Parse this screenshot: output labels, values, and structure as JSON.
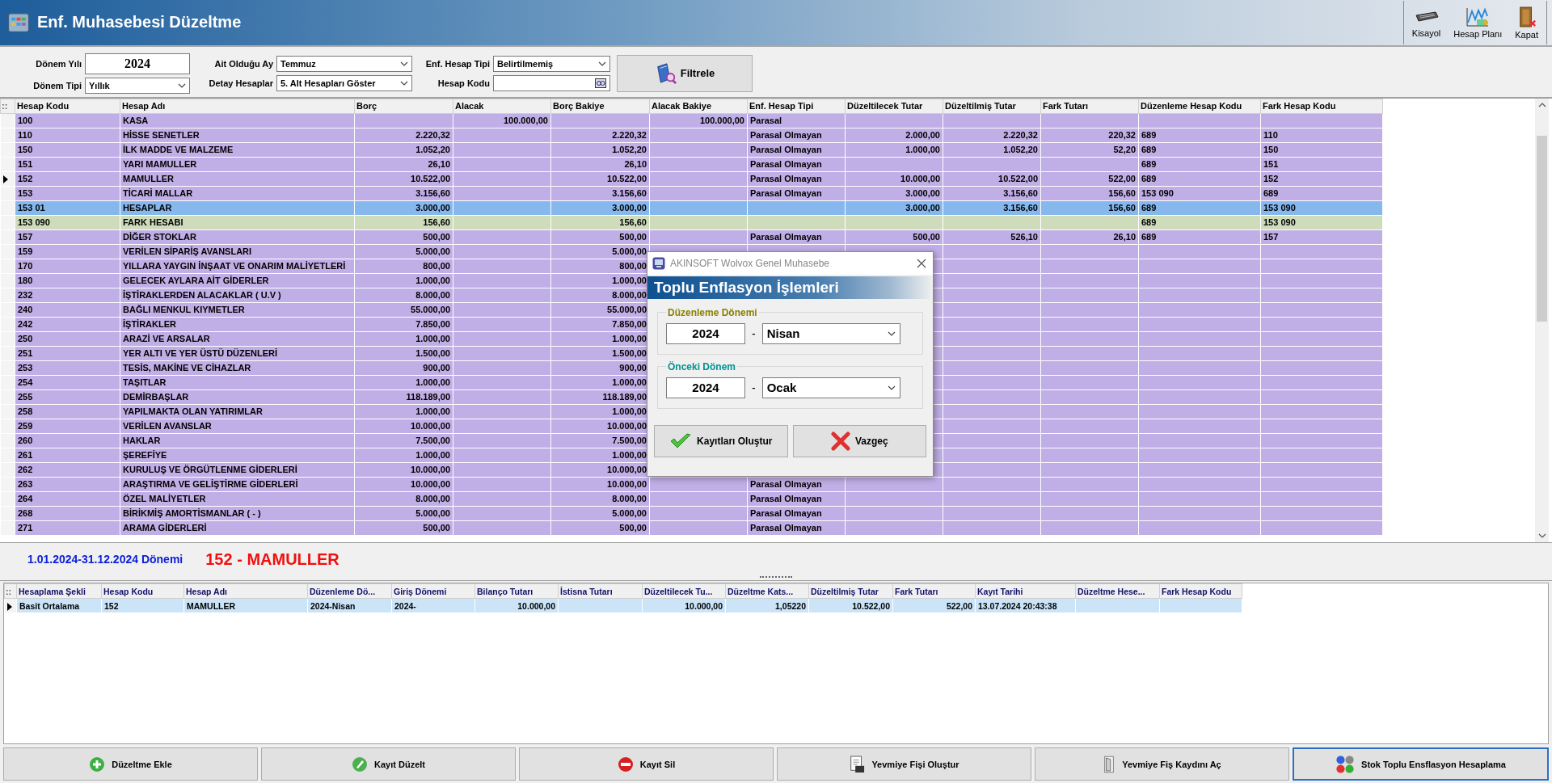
{
  "window": {
    "title": "Enf. Muhasebesi Düzeltme"
  },
  "toolbar": [
    {
      "label": "Kisayol",
      "kind": "keyboard"
    },
    {
      "label": "Hesap Planı",
      "kind": "chart"
    },
    {
      "label": "Kapat",
      "kind": "exit"
    }
  ],
  "filters": {
    "donem_yili": {
      "label": "Dönem Yılı",
      "value": "2024"
    },
    "donem_tipi": {
      "label": "Dönem Tipi",
      "value": "Yıllık"
    },
    "ait_oldugu_ay": {
      "label": "Ait Olduğu Ay",
      "value": "Temmuz"
    },
    "detay_hesaplar": {
      "label": "Detay Hesaplar",
      "value": "5. Alt Hesapları Göster"
    },
    "enf_hesap_tipi": {
      "label": "Enf. Hesap Tipi",
      "value": "Belirtilmemiş"
    },
    "hesap_kodu": {
      "label": "Hesap Kodu"
    },
    "filter_button": "Filtrele"
  },
  "main_grid": {
    "corner": "::",
    "columns": [
      "Hesap Kodu",
      "Hesap Adı",
      "Borç",
      "Alacak",
      "Borç Bakiye",
      "Alacak Bakiye",
      "Enf. Hesap Tipi",
      "Düzeltilecek Tutar",
      "Düzeltilmiş Tutar",
      "Fark Tutarı",
      "Düzenleme Hesap Kodu",
      "Fark Hesap Kodu"
    ],
    "rows": [
      {
        "kind": "account",
        "selected": false,
        "cells": [
          "100",
          "KASA",
          null,
          "100.000,00",
          null,
          "100.000,00",
          "Parasal",
          null,
          null,
          null,
          null,
          null
        ]
      },
      {
        "kind": "account",
        "selected": false,
        "cells": [
          "110",
          "HİSSE SENETLER",
          "2.220,32",
          null,
          "2.220,32",
          null,
          "Parasal Olmayan",
          "2.000,00",
          "2.220,32",
          "220,32",
          "689",
          "110"
        ]
      },
      {
        "kind": "account",
        "selected": false,
        "cells": [
          "150",
          "İLK MADDE VE MALZEME",
          "1.052,20",
          null,
          "1.052,20",
          null,
          "Parasal Olmayan",
          "1.000,00",
          "1.052,20",
          "52,20",
          "689",
          "150"
        ]
      },
      {
        "kind": "account",
        "selected": false,
        "cells": [
          "151",
          "YARI MAMULLER",
          "26,10",
          null,
          "26,10",
          null,
          "Parasal Olmayan",
          null,
          null,
          null,
          "689",
          "151"
        ]
      },
      {
        "kind": "account",
        "selected": true,
        "cells": [
          "152",
          "MAMULLER",
          "10.522,00",
          null,
          "10.522,00",
          null,
          "Parasal Olmayan",
          "10.000,00",
          "10.522,00",
          "522,00",
          "689",
          "152"
        ]
      },
      {
        "kind": "account",
        "selected": false,
        "cells": [
          "153",
          "TİCARİ MALLAR",
          "3.156,60",
          null,
          "3.156,60",
          null,
          "Parasal Olmayan",
          "3.000,00",
          "3.156,60",
          "156,60",
          "153 090",
          "689"
        ]
      },
      {
        "kind": "sub",
        "selected": false,
        "cells": [
          "153 01",
          "HESAPLAR",
          "3.000,00",
          null,
          "3.000,00",
          null,
          null,
          "3.000,00",
          "3.156,60",
          "156,60",
          "689",
          "153 090"
        ]
      },
      {
        "kind": "difference",
        "selected": false,
        "cells": [
          "153 090",
          "FARK HESABI",
          "156,60",
          null,
          "156,60",
          null,
          null,
          null,
          null,
          null,
          "689",
          "153 090"
        ]
      },
      {
        "kind": "account",
        "selected": false,
        "cells": [
          "157",
          "DİĞER STOKLAR",
          "500,00",
          null,
          "500,00",
          null,
          "Parasal Olmayan",
          "500,00",
          "526,10",
          "26,10",
          "689",
          "157"
        ]
      },
      {
        "kind": "account",
        "selected": false,
        "cells": [
          "159",
          "VERİLEN SİPARİŞ AVANSLARI",
          "5.000,00",
          null,
          "5.000,00",
          null,
          null,
          null,
          null,
          null,
          null,
          null
        ]
      },
      {
        "kind": "account",
        "selected": false,
        "cells": [
          "170",
          "YILLARA YAYGIN İNŞAAT VE ONARIM MALİYETLERİ",
          "800,00",
          null,
          "800,00",
          null,
          null,
          null,
          null,
          null,
          null,
          null
        ]
      },
      {
        "kind": "account",
        "selected": false,
        "cells": [
          "180",
          "GELECEK AYLARA AİT GİDERLER",
          "1.000,00",
          null,
          "1.000,00",
          null,
          null,
          null,
          null,
          null,
          null,
          null
        ]
      },
      {
        "kind": "account",
        "selected": false,
        "cells": [
          "232",
          "İŞTİRAKLERDEN ALACAKLAR  ( U.V )",
          "8.000,00",
          null,
          "8.000,00",
          null,
          null,
          null,
          null,
          null,
          null,
          null
        ]
      },
      {
        "kind": "account",
        "selected": false,
        "cells": [
          "240",
          "BAĞLI MENKUL KIYMETLER",
          "55.000,00",
          null,
          "55.000,00",
          null,
          null,
          null,
          null,
          null,
          null,
          null
        ]
      },
      {
        "kind": "account",
        "selected": false,
        "cells": [
          "242",
          "İŞTİRAKLER",
          "7.850,00",
          null,
          "7.850,00",
          null,
          null,
          null,
          null,
          null,
          null,
          null
        ]
      },
      {
        "kind": "account",
        "selected": false,
        "cells": [
          "250",
          "ARAZİ VE ARSALAR",
          "1.000,00",
          null,
          "1.000,00",
          null,
          null,
          null,
          null,
          null,
          null,
          null
        ]
      },
      {
        "kind": "account",
        "selected": false,
        "cells": [
          "251",
          "YER ALTI VE YER ÜSTÜ DÜZENLERİ",
          "1.500,00",
          null,
          "1.500,00",
          null,
          null,
          null,
          null,
          null,
          null,
          null
        ]
      },
      {
        "kind": "account",
        "selected": false,
        "cells": [
          "253",
          "TESİS, MAKİNE VE CİHAZLAR",
          "900,00",
          null,
          "900,00",
          null,
          null,
          null,
          null,
          null,
          null,
          null
        ]
      },
      {
        "kind": "account",
        "selected": false,
        "cells": [
          "254",
          "TAŞITLAR",
          "1.000,00",
          null,
          "1.000,00",
          null,
          null,
          null,
          null,
          null,
          null,
          null
        ]
      },
      {
        "kind": "account",
        "selected": false,
        "cells": [
          "255",
          "DEMİRBAŞLAR",
          "118.189,00",
          null,
          "118.189,00",
          null,
          null,
          null,
          null,
          null,
          null,
          null
        ]
      },
      {
        "kind": "account",
        "selected": false,
        "cells": [
          "258",
          "YAPILMAKTA OLAN YATIRIMLAR",
          "1.000,00",
          null,
          "1.000,00",
          null,
          null,
          null,
          null,
          null,
          null,
          null
        ]
      },
      {
        "kind": "account",
        "selected": false,
        "cells": [
          "259",
          "VERİLEN AVANSLAR",
          "10.000,00",
          null,
          "10.000,00",
          null,
          null,
          null,
          null,
          null,
          null,
          null
        ]
      },
      {
        "kind": "account",
        "selected": false,
        "cells": [
          "260",
          "HAKLAR",
          "7.500,00",
          null,
          "7.500,00",
          null,
          null,
          null,
          null,
          null,
          null,
          null
        ]
      },
      {
        "kind": "account",
        "selected": false,
        "cells": [
          "261",
          "ŞEREFİYE",
          "1.000,00",
          null,
          "1.000,00",
          null,
          null,
          null,
          null,
          null,
          null,
          null
        ]
      },
      {
        "kind": "account",
        "selected": false,
        "cells": [
          "262",
          "KURULUŞ VE ÖRGÜTLENME GİDERLERİ",
          "10.000,00",
          null,
          "10.000,00",
          null,
          null,
          null,
          null,
          null,
          null,
          null
        ]
      },
      {
        "kind": "account",
        "selected": false,
        "cells": [
          "263",
          "ARAŞTIRMA VE GELİŞTİRME GİDERLERİ",
          "10.000,00",
          null,
          "10.000,00",
          null,
          "Parasal Olmayan",
          null,
          null,
          null,
          null,
          null
        ]
      },
      {
        "kind": "account",
        "selected": false,
        "cells": [
          "264",
          "ÖZEL MALİYETLER",
          "8.000,00",
          null,
          "8.000,00",
          null,
          "Parasal Olmayan",
          null,
          null,
          null,
          null,
          null
        ]
      },
      {
        "kind": "account",
        "selected": false,
        "cells": [
          "268",
          "BİRİKMİŞ AMORTİSMANLAR ( - )",
          "5.000,00",
          null,
          "5.000,00",
          null,
          "Parasal Olmayan",
          null,
          null,
          null,
          null,
          null
        ]
      },
      {
        "kind": "account",
        "selected": false,
        "cells": [
          "271",
          "ARAMA GİDERLERİ",
          "500,00",
          null,
          "500,00",
          null,
          "Parasal Olmayan",
          null,
          null,
          null,
          null,
          null
        ]
      }
    ]
  },
  "period_label": "1.01.2024-31.12.2024 Dönemi",
  "selected_account": "152 - MAMULLER",
  "detail_grid": {
    "corner": "::",
    "columns": [
      "Hesaplama Şekli",
      "Hesap Kodu",
      "Hesap Adı",
      "Düzenleme Dö...",
      "Giriş Dönemi",
      "Bilanço Tutarı",
      "İstisna Tutarı",
      "Düzeltilecek Tu...",
      "Düzeltme Kats...",
      "Düzeltilmiş Tutar",
      "Fark Tutarı",
      "Kayıt Tarihi",
      "Düzeltme Hese...",
      "Fark Hesap Kodu"
    ],
    "rows": [
      {
        "selected": true,
        "cells": [
          "Basit Ortalama",
          "152",
          "MAMULLER",
          "2024-Nisan",
          "2024-",
          "10.000,00",
          null,
          "10.000,00",
          "1,05220",
          "10.522,00",
          "522,00",
          "13.07.2024 20:43:38",
          null,
          null
        ]
      }
    ]
  },
  "buttons": [
    {
      "label": "Düzeltme Ekle",
      "kind": "add",
      "focused": false
    },
    {
      "label": "Kayıt Düzelt",
      "kind": "edit",
      "focused": false
    },
    {
      "label": "Kayıt Sil",
      "kind": "delete",
      "focused": false
    },
    {
      "label": "Yevmiye Fişi Oluştur",
      "kind": "voucher",
      "focused": false
    },
    {
      "label": "Yevmiye Fiş Kaydını Aç",
      "kind": "open",
      "focused": false
    },
    {
      "label": "Stok Toplu Ensflasyon Hesaplama",
      "kind": "batch",
      "focused": true
    }
  ],
  "dialog": {
    "title": "AKINSOFT Wolvox Genel Muhasebe",
    "heading": "Toplu Enflasyon İşlemleri",
    "separator": "-",
    "groups": [
      {
        "legend": "Düzenleme Dönemi",
        "color": "#8b8000",
        "year": "2024",
        "month": "Nisan"
      },
      {
        "legend": "Önceki Dönem",
        "color": "#00948f",
        "year": "2024",
        "month": "Ocak"
      }
    ],
    "buttons": [
      {
        "label": "Kayıtları Oluştur",
        "kind": "confirm"
      },
      {
        "label": "Vazgeç",
        "kind": "cancel"
      }
    ]
  }
}
